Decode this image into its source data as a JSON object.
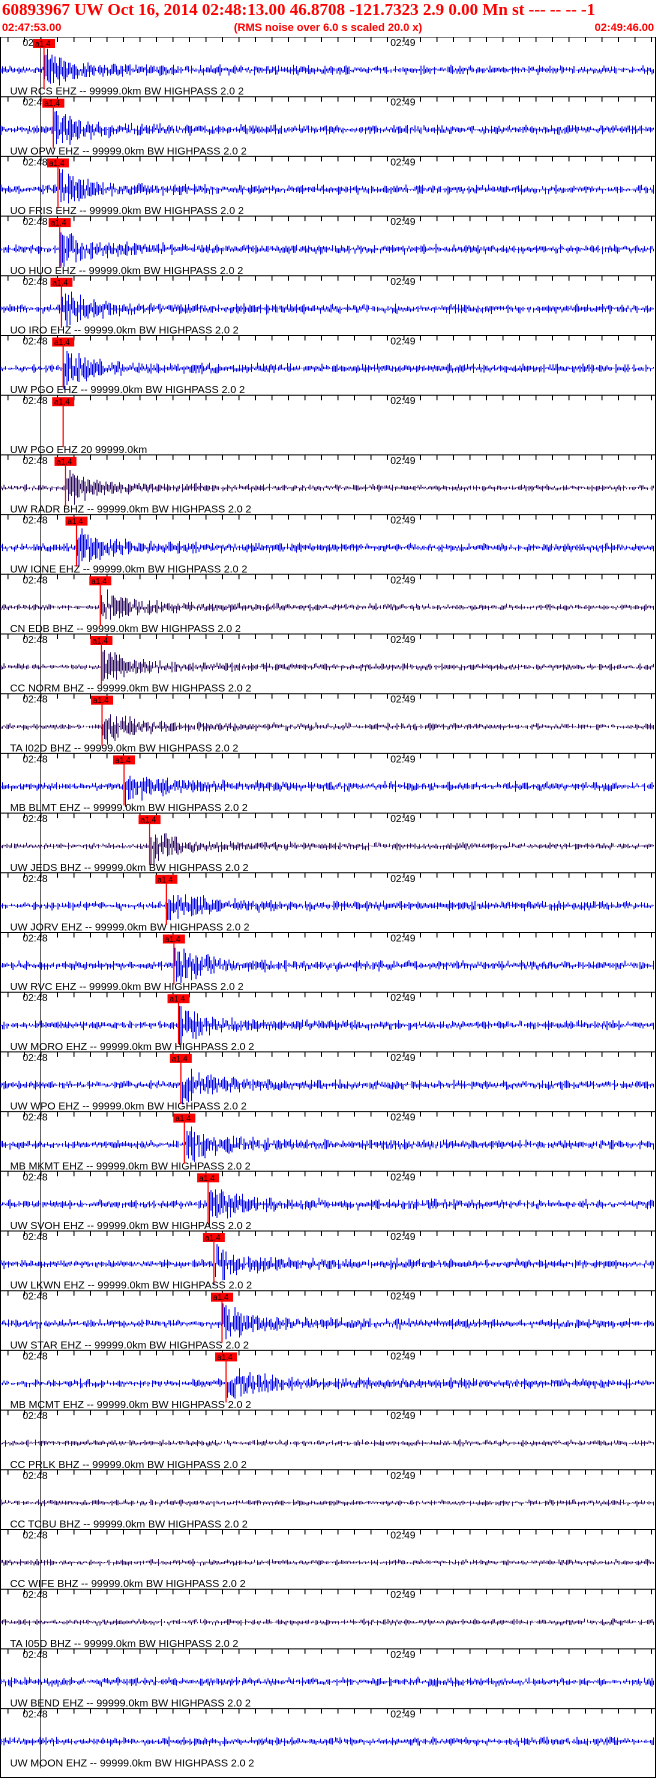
{
  "header": {
    "title": "60893967 UW Oct 16, 2014 02:48:13.00   46.8708 -121.7323  2.9 0.00 Mn st --- -- --   -1",
    "start_time": "02:47:53.00",
    "rms_note": "(RMS noise over 6.0 s scaled 20.0 x)",
    "end_time": "02:49:46.00"
  },
  "colors": {
    "title": "#ff0000",
    "trace_blue": "#0000ee",
    "trace_dark": "#2a0a5e",
    "pick": "#ff0000",
    "axis": "#000000"
  },
  "chart_data": {
    "type": "line",
    "title": "60893967 UW Oct 16, 2014 02:48:13.00   46.8708 -121.7323  2.9 0.00 Mn st --- -- --   -1",
    "x_range": [
      "02:47:53.00",
      "02:49:46.00"
    ],
    "x_ticks": [
      "02:48",
      "02:49"
    ],
    "pick_label": "a1.4",
    "grid": false,
    "series": [
      {
        "name": "UW RCS EHZ -- 99999.0km BW  HIGHPASS  2.0  2",
        "color": "blue",
        "pick": "02:48:00.6"
      },
      {
        "name": "UW OPW EHZ -- 99999.0km BW  HIGHPASS  2.0  2",
        "color": "blue",
        "pick": "02:48:02.2"
      },
      {
        "name": "UO FRIS EHZ -- 99999.0km BW  HIGHPASS  2.0  2",
        "color": "blue",
        "pick": "02:48:03.0"
      },
      {
        "name": "UO HUO EHZ -- 99999.0km BW  HIGHPASS  2.0  2",
        "color": "blue",
        "pick": "02:48:03.3"
      },
      {
        "name": "UO IRO EHZ -- 99999.0km BW  HIGHPASS  2.0  2",
        "color": "blue",
        "pick": "02:48:03.6"
      },
      {
        "name": "UW PGO EHZ -- 99999.0km BW  HIGHPASS  2.0  2",
        "color": "blue",
        "pick": "02:48:03.9"
      },
      {
        "name": "UW PGO EHZ 20 99999.0km",
        "color": "none",
        "pick": "02:48:03.9"
      },
      {
        "name": "UW RADR BHZ -- 99999.0km BW  HIGHPASS  2.0  2",
        "color": "dark",
        "pick": "02:48:04.3"
      },
      {
        "name": "UW IONE EHZ -- 99999.0km BW  HIGHPASS  2.0  2",
        "color": "blue",
        "pick": "02:48:06.2"
      },
      {
        "name": "CN EDB BHZ -- 99999.0km BW  HIGHPASS  2.0  2",
        "color": "dark",
        "pick": "02:48:10.3"
      },
      {
        "name": "CC NORM BHZ -- 99999.0km BW  HIGHPASS  2.0  2",
        "color": "dark",
        "pick": "02:48:10.5"
      },
      {
        "name": "TA I02D BHZ -- 99999.0km BW  HIGHPASS  2.0  2",
        "color": "dark",
        "pick": "02:48:10.6"
      },
      {
        "name": "MB BLMT EHZ -- 99999.0km BW  HIGHPASS  2.0  2",
        "color": "blue",
        "pick": "02:48:14.4"
      },
      {
        "name": "UW JEDS BHZ -- 99999.0km BW  HIGHPASS  2.0  2",
        "color": "dark",
        "pick": "02:48:18.8"
      },
      {
        "name": "UW JORV EHZ -- 99999.0km BW  HIGHPASS  2.0  2",
        "color": "blue",
        "pick": "02:48:21.7"
      },
      {
        "name": "UW RVC EHZ -- 99999.0km BW  HIGHPASS  2.0  2",
        "color": "blue",
        "pick": "02:48:23.0"
      },
      {
        "name": "UW MORO EHZ -- 99999.0km BW  HIGHPASS  2.0  2",
        "color": "blue",
        "pick": "02:48:23.8"
      },
      {
        "name": "UW WPO EHZ -- 99999.0km BW  HIGHPASS  2.0  2",
        "color": "blue",
        "pick": "02:48:24.2"
      },
      {
        "name": "MB MKMT EHZ -- 99999.0km BW  HIGHPASS  2.0  2",
        "color": "blue",
        "pick": "02:48:24.8"
      },
      {
        "name": "UW SVOH EHZ -- 99999.0km BW  HIGHPASS  2.0  2",
        "color": "blue",
        "pick": "02:48:28.9"
      },
      {
        "name": "UW LKWN EHZ -- 99999.0km BW  HIGHPASS  2.0  2",
        "color": "blue",
        "pick": "02:48:29.9"
      },
      {
        "name": "UW STAR EHZ -- 99999.0km BW  HIGHPASS  2.0  2",
        "color": "blue",
        "pick": "02:48:31.3"
      },
      {
        "name": "MB MCMT EHZ -- 99999.0km BW  HIGHPASS  2.0  2",
        "color": "blue",
        "pick": "02:48:32.0"
      },
      {
        "name": "CC PRLK BHZ -- 99999.0km BW  HIGHPASS  2.0  2",
        "color": "dark",
        "pick": ""
      },
      {
        "name": "CC TCBU BHZ -- 99999.0km BW  HIGHPASS  2.0  2",
        "color": "dark",
        "pick": ""
      },
      {
        "name": "CC WIFE BHZ -- 99999.0km BW  HIGHPASS  2.0  2",
        "color": "dark",
        "pick": ""
      },
      {
        "name": "TA I05D BHZ -- 99999.0km BW  HIGHPASS  2.0  2",
        "color": "dark",
        "pick": ""
      },
      {
        "name": "UW BEND EHZ -- 99999.0km BW  HIGHPASS  2.0  2",
        "color": "blue",
        "pick": ""
      },
      {
        "name": "UW MOON EHZ -- 99999.0km BW  HIGHPASS  2.0  2",
        "color": "blue",
        "pick": ""
      }
    ]
  }
}
